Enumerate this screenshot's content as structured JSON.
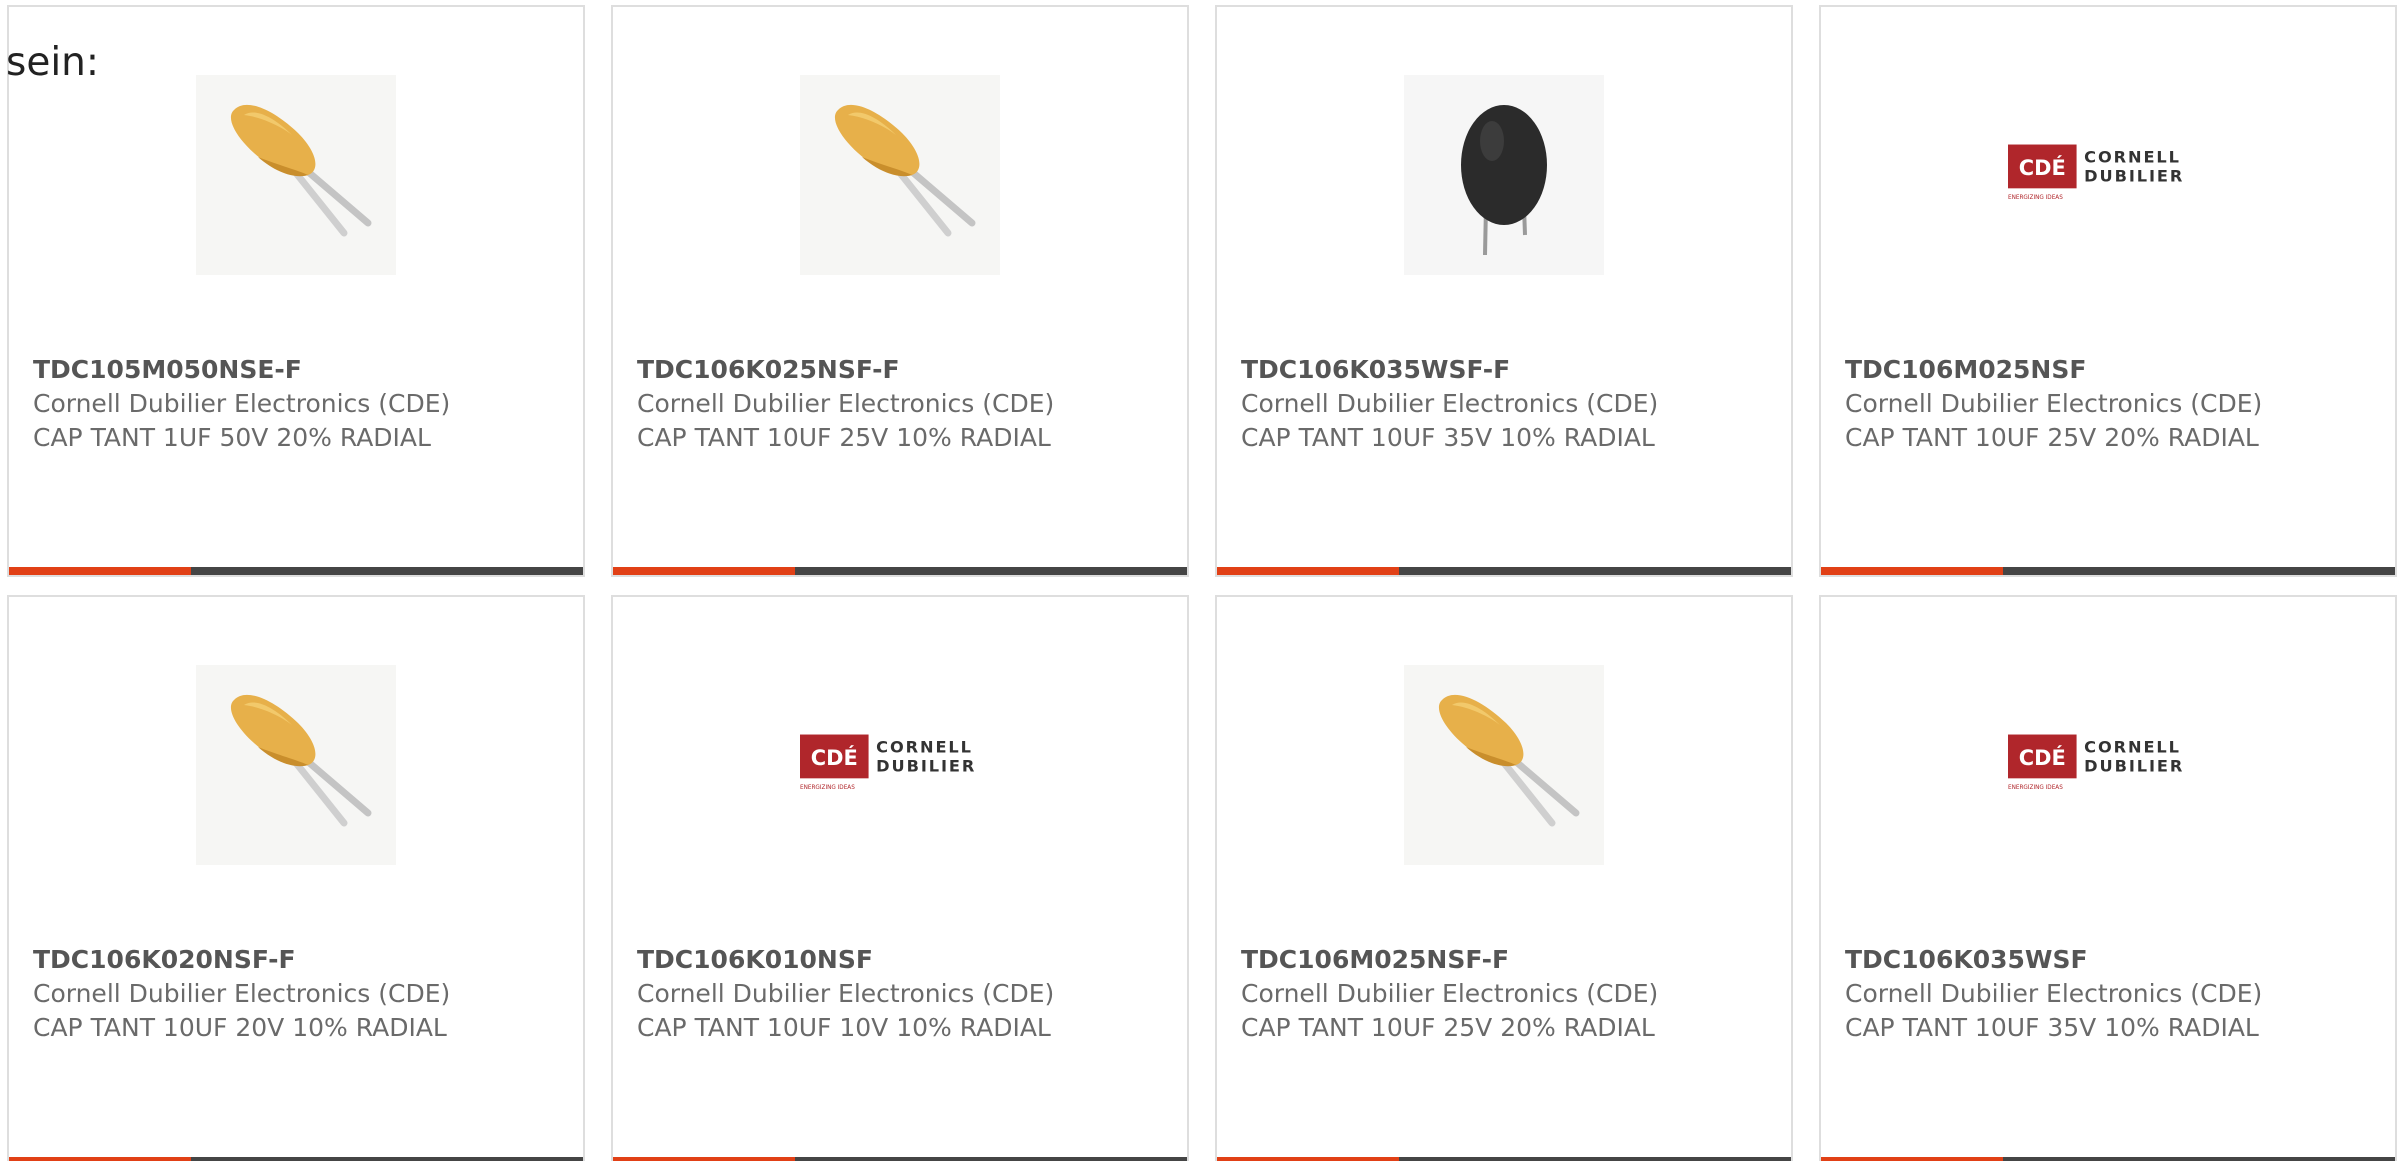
{
  "intro_text": "sein:",
  "accent_color": "#e14016",
  "bar_color": "#454545",
  "products": [
    {
      "part_number": "TDC105M050NSE-F",
      "manufacturer": "Cornell Dubilier Electronics (CDE)",
      "description": "CAP TANT 1UF 50V 20% RADIAL",
      "image": "tantalum-capacitor-yellow"
    },
    {
      "part_number": "TDC106K025NSF-F",
      "manufacturer": "Cornell Dubilier Electronics (CDE)",
      "description": "CAP TANT 10UF 25V 10% RADIAL",
      "image": "tantalum-capacitor-yellow"
    },
    {
      "part_number": "TDC106K035WSF-F",
      "manufacturer": "Cornell Dubilier Electronics (CDE)",
      "description": "CAP TANT 10UF 35V 10% RADIAL",
      "image": "tantalum-capacitor-black"
    },
    {
      "part_number": "TDC106M025NSF",
      "manufacturer": "Cornell Dubilier Electronics (CDE)",
      "description": "CAP TANT 10UF 25V 20% RADIAL",
      "image": "cde-logo",
      "logo_text": [
        "CDÉ",
        "CORNELL",
        "DUBILIER",
        "ENERGIZING IDEAS"
      ]
    },
    {
      "part_number": "TDC106K020NSF-F",
      "manufacturer": "Cornell Dubilier Electronics (CDE)",
      "description": "CAP TANT 10UF 20V 10% RADIAL",
      "image": "tantalum-capacitor-yellow"
    },
    {
      "part_number": "TDC106K010NSF",
      "manufacturer": "Cornell Dubilier Electronics (CDE)",
      "description": "CAP TANT 10UF 10V 10% RADIAL",
      "image": "cde-logo",
      "logo_text": [
        "CDÉ",
        "CORNELL",
        "DUBILIER",
        "ENERGIZING IDEAS"
      ]
    },
    {
      "part_number": "TDC106M025NSF-F",
      "manufacturer": "Cornell Dubilier Electronics (CDE)",
      "description": "CAP TANT 10UF 25V 20% RADIAL",
      "image": "tantalum-capacitor-yellow"
    },
    {
      "part_number": "TDC106K035WSF",
      "manufacturer": "Cornell Dubilier Electronics (CDE)",
      "description": "CAP TANT 10UF 35V 10% RADIAL",
      "image": "cde-logo",
      "logo_text": [
        "CDÉ",
        "CORNELL",
        "DUBILIER",
        "ENERGIZING IDEAS"
      ]
    }
  ]
}
